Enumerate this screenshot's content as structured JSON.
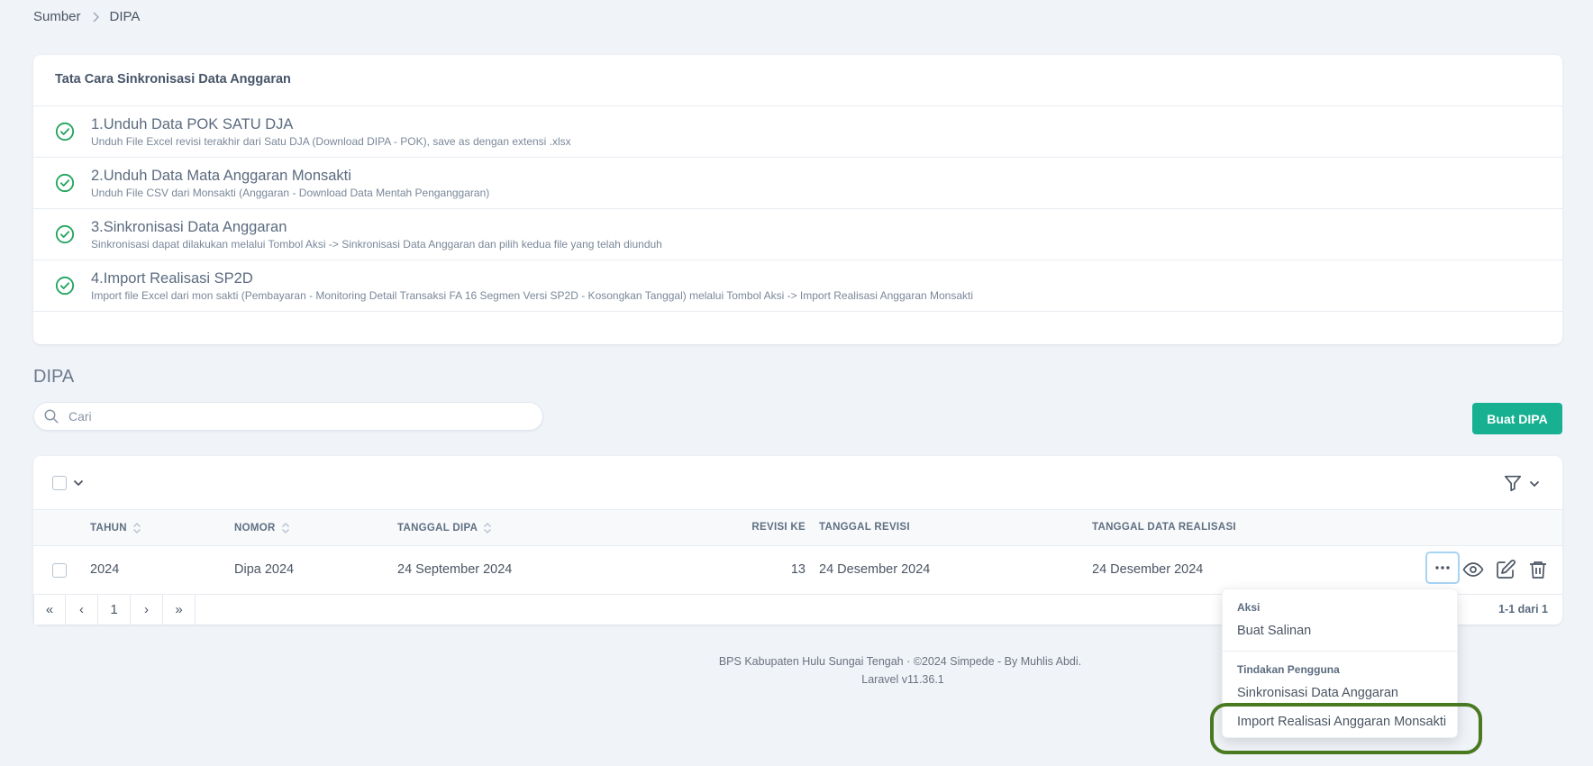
{
  "breadcrumb": {
    "items": [
      "Sumber",
      "DIPA"
    ]
  },
  "steps": {
    "title": "Tata Cara Sinkronisasi Data Anggaran",
    "items": [
      {
        "title": "1.Unduh Data POK SATU DJA",
        "desc": "Unduh File Excel revisi terakhir dari Satu DJA (Download DIPA - POK), save as dengan extensi .xlsx"
      },
      {
        "title": "2.Unduh Data Mata Anggaran Monsakti",
        "desc": "Unduh File CSV dari Monsakti (Anggaran - Download Data Mentah Penganggaran)"
      },
      {
        "title": "3.Sinkronisasi Data Anggaran",
        "desc": "Sinkronisasi dapat dilakukan melalui Tombol Aksi -> Sinkronisasi Data Anggaran dan pilih kedua file yang telah diunduh"
      },
      {
        "title": "4.Import Realisasi SP2D",
        "desc": "Import file Excel dari mon sakti (Pembayaran - Monitoring Detail Transaksi FA 16 Segmen Versi SP2D - Kosongkan Tanggal) melalui Tombol Aksi -> Import Realisasi Anggaran Monsakti"
      }
    ],
    "check_color": "#22a45d"
  },
  "section": {
    "title": "DIPA"
  },
  "search": {
    "placeholder": "Cari",
    "value": ""
  },
  "create_button": {
    "label": "Buat DIPA",
    "color": "#17b192"
  },
  "table": {
    "headers": {
      "tahun": "TAHUN",
      "nomor": "NOMOR",
      "tanggal_dipa": "TANGGAL DIPA",
      "revisi_ke": "REVISI KE",
      "tanggal_revisi": "TANGGAL REVISI",
      "tanggal_data_realisasi": "TANGGAL DATA REALISASI"
    },
    "rows": [
      {
        "tahun": "2024",
        "nomor": "Dipa 2024",
        "tanggal_dipa": "24 September 2024",
        "revisi_ke": "13",
        "tanggal_revisi": "24 Desember 2024",
        "tanggal_data_realisasi": "24 Desember 2024"
      }
    ]
  },
  "pagination": {
    "first": "«",
    "prev": "‹",
    "current": "1",
    "next": "›",
    "last": "»",
    "info": "1-1 dari 1"
  },
  "dropdown": {
    "group1": {
      "heading": "Aksi",
      "items": [
        "Buat Salinan"
      ]
    },
    "group2": {
      "heading": "Tindakan Pengguna",
      "items": [
        "Sinkronisasi Data Anggaran",
        "Import Realisasi Anggaran Monsakti"
      ]
    }
  },
  "footer": {
    "line1": "BPS Kabupaten Hulu Sungai Tengah  ·  ©2024 Simpede - By Muhlis Abdi.",
    "line2": "Laravel v11.36.1"
  }
}
